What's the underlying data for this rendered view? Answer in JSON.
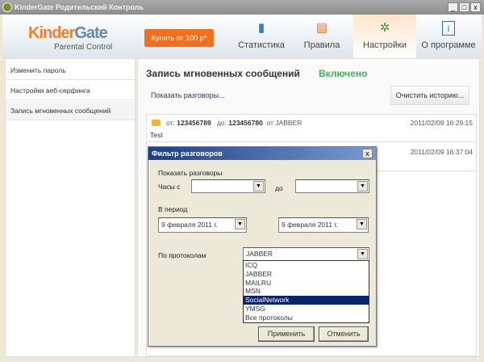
{
  "window": {
    "title": "KinderGate Родительский Контроль",
    "min": "_",
    "max": "□",
    "close": "x"
  },
  "header": {
    "logo_kinder": "Kinder",
    "logo_gate": "Gate",
    "logo_sub": "Parental Control",
    "buy_label": "Купить от 100 р*",
    "tabs": [
      {
        "label": "Статистика",
        "icon": "▮"
      },
      {
        "label": "Правила",
        "icon": "▤"
      },
      {
        "label": "Настройки",
        "icon": "✲"
      },
      {
        "label": "О программе",
        "icon": "i"
      }
    ]
  },
  "sidebar": {
    "items": [
      {
        "label": "Изменить пароль"
      },
      {
        "label": "Настройки веб-серфинга"
      },
      {
        "label": "Запись мгновенных сообщений"
      }
    ]
  },
  "content": {
    "title": "Запись мгновенных сообщений",
    "status": "Включено",
    "status_color": "#3cb35a",
    "show_link": "Показать разговоры...",
    "clear_button": "Очистить историю...",
    "messages": [
      {
        "from_label": "от:",
        "from": "123456789",
        "to_label": "до:",
        "to": "123456780",
        "via": "от JABBER",
        "timestamp": "2011/02/09 16:29:15",
        "text": "Test"
      },
      {
        "timestamp": "2011/02/09 16:37:04"
      }
    ]
  },
  "dialog": {
    "title": "Фильтр разговоров",
    "close": "x",
    "show_label": "Показать разговоры",
    "hours_from": "Часы с",
    "hours_to": "до",
    "hours_from_value": "",
    "hours_to_value": "",
    "period_label": "В период",
    "date_from": "9 февраля  2011 г.",
    "date_to": "9 февраля  2011 г.",
    "protocol_label": "По протоколам",
    "protocol_value": "JABBER",
    "protocol_options": [
      "ICQ",
      "JABBER",
      "MAILRU",
      "MSN",
      "SocialNetwork",
      "YMSG",
      "Все протоколы"
    ],
    "highlighted": "SocialNetwork",
    "apply": "Применить",
    "cancel": "Отменить",
    "arrow": "▼"
  }
}
